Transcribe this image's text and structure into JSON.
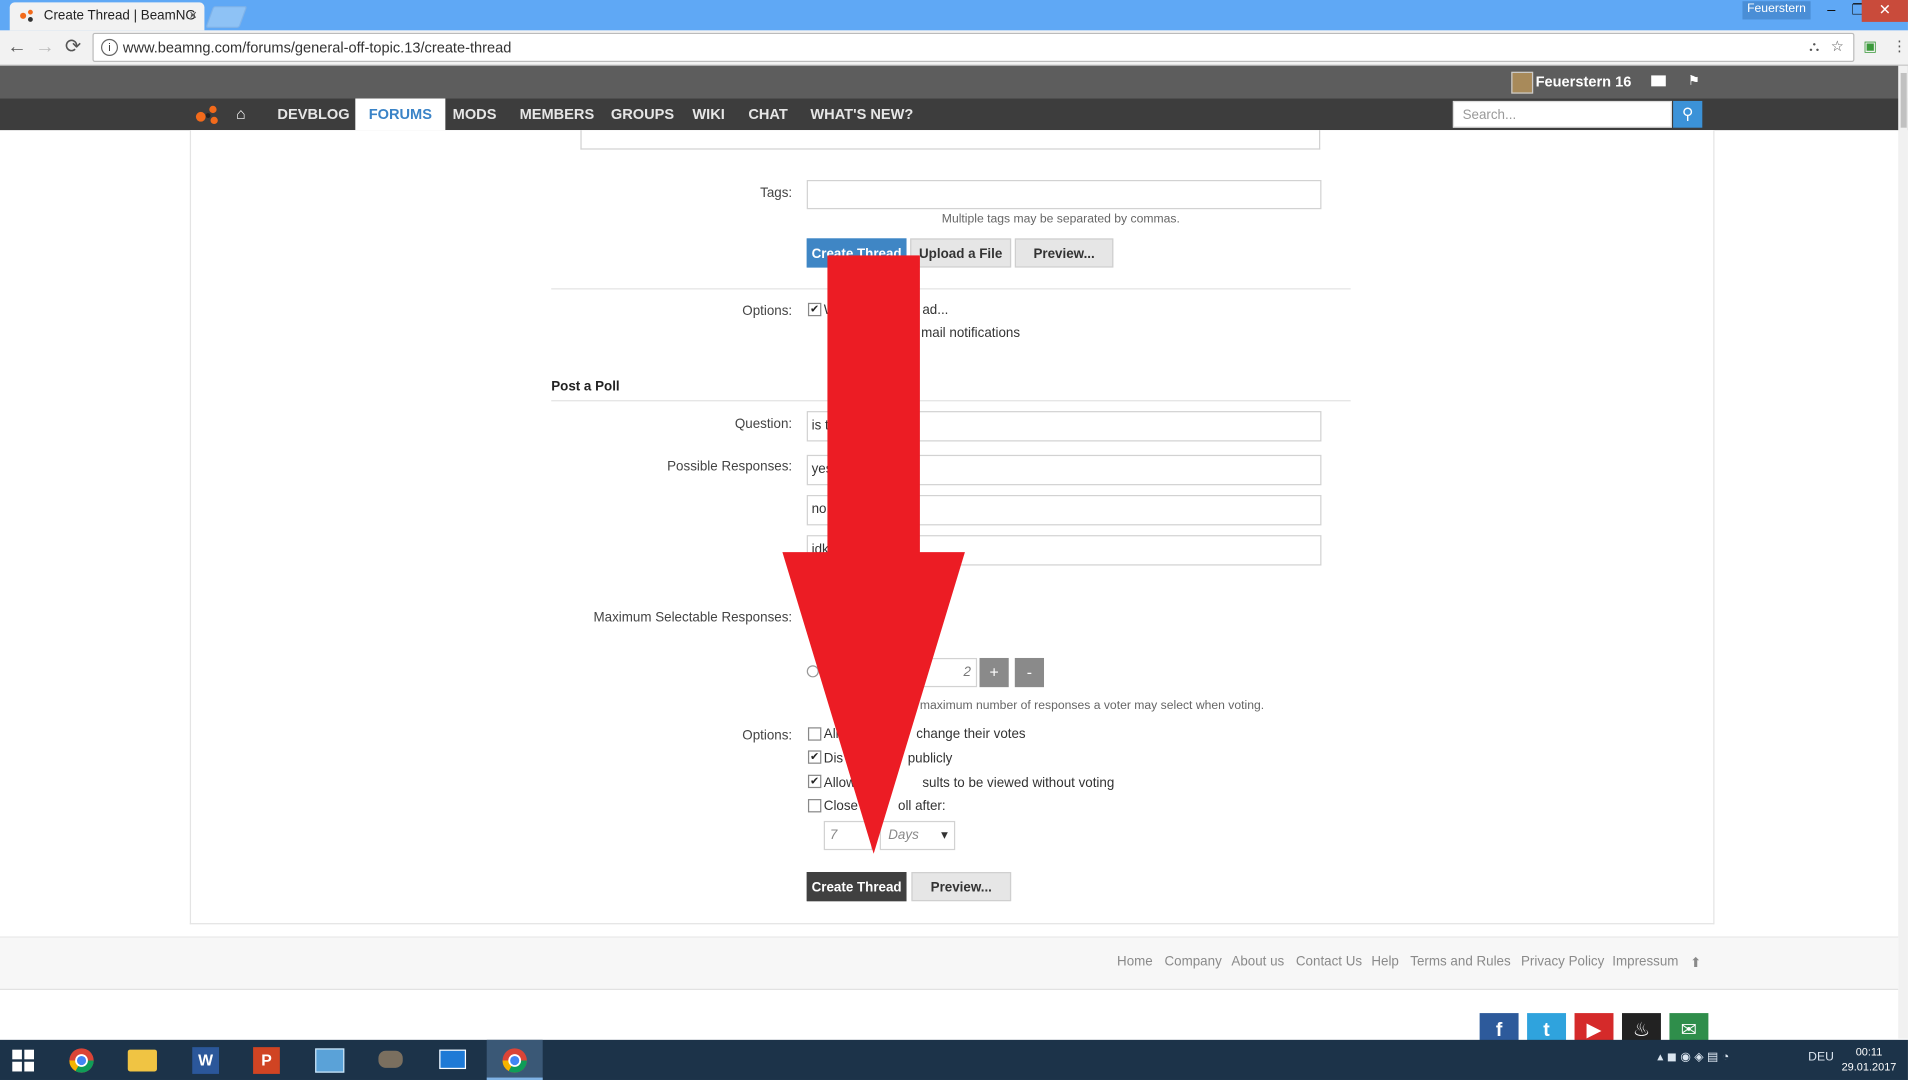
{
  "browser": {
    "tab_title": "Create Thread | BeamNG",
    "tab_close": "×",
    "profile_name": "Feuerstern",
    "url": "www.beamng.com/forums/general-off-topic.13/create-thread",
    "win_minimize": "–",
    "win_maximize": "❐",
    "win_close": "✕",
    "nav_back": "←",
    "nav_forward": "→",
    "nav_reload": "⟳",
    "info_glyph": "i",
    "translate_glyph": "⛬",
    "star_glyph": "☆",
    "ext_glyph": "▣",
    "menu_glyph": "⋮"
  },
  "site": {
    "username": "Feuerstern 16",
    "flag_glyph": "⚑",
    "home_glyph": "⌂",
    "nav": [
      "DEVBLOG",
      "FORUMS",
      "MODS",
      "MEMBERS",
      "GROUPS",
      "WIKI",
      "CHAT",
      "WHAT'S NEW?"
    ],
    "active_nav": "FORUMS",
    "search_placeholder": "Search...",
    "search_glyph": "⚲"
  },
  "form": {
    "tags_label": "Tags:",
    "tags_value": "",
    "tags_hint": "Multiple tags may be separated by commas.",
    "btn_create_thread_top": "Create Thread",
    "btn_upload": "Upload a File",
    "btn_preview_top": "Preview...",
    "options_label": "Options:",
    "opt_watch_a": "W",
    "opt_watch_b": "ad...",
    "opt_email": "mail notifications",
    "poll_title": "Post a Poll",
    "question_label": "Question:",
    "question_value": "is t",
    "responses_label": "Possible Responses:",
    "responses": [
      "yes",
      "no",
      "idk"
    ],
    "max_label": "Maximum Selectable Responses:",
    "max_value": "2",
    "plus": "+",
    "minus": "-",
    "max_hint": "maximum number of responses a voter may select when voting.",
    "poll_options_label": "Options:",
    "poll_options": [
      {
        "a": "All",
        "b": "change their votes",
        "checked": false
      },
      {
        "a": "Dis",
        "b": "publicly",
        "checked": true
      },
      {
        "a": "Allow",
        "b": "sults to be viewed without voting",
        "checked": true
      },
      {
        "a": "Close",
        "b": "oll after:",
        "checked": false
      }
    ],
    "close_after_value": "7",
    "close_after_unit": "Days",
    "dropdown_glyph": "▾",
    "checkmark": "✔",
    "btn_create_thread": "Create Thread",
    "btn_preview": "Preview..."
  },
  "footer": {
    "links": [
      "Home",
      "Company",
      "About us",
      "Contact Us",
      "Help",
      "Terms and Rules",
      "Privacy Policy",
      "Impressum"
    ],
    "top_glyph": "⬆",
    "social": [
      {
        "name": "facebook",
        "glyph": "f",
        "color": "#2d5a9b"
      },
      {
        "name": "twitter",
        "glyph": "t",
        "color": "#2fa3dd"
      },
      {
        "name": "youtube",
        "glyph": "▶",
        "color": "#d52a2a"
      },
      {
        "name": "steam",
        "glyph": "♨",
        "color": "#222222"
      },
      {
        "name": "email",
        "glyph": "✉",
        "color": "#2f8e4b"
      }
    ]
  },
  "taskbar": {
    "language": "DEU",
    "time": "00:11",
    "date": "29.01.2017",
    "tray_glyphs": "▴  ◼  ◉  ◈  ▤  ◔"
  },
  "colors": {
    "arrow": "#ec1c24",
    "accent": "#3f86c5",
    "titlebar": "#5fa8f5"
  }
}
